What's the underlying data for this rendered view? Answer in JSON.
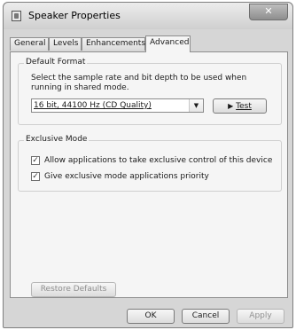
{
  "window": {
    "title": "Speaker Properties",
    "close_glyph": "✕"
  },
  "tabs": [
    {
      "label": "General"
    },
    {
      "label": "Levels"
    },
    {
      "label": "Enhancements"
    },
    {
      "label": "Advanced"
    }
  ],
  "active_tab": "Advanced",
  "default_format": {
    "legend": "Default Format",
    "description": "Select the sample rate and bit depth to be used when running in shared mode.",
    "selected_format": "16 bit, 44100 Hz (CD Quality)",
    "test_label": "Test"
  },
  "exclusive_mode": {
    "legend": "Exclusive Mode",
    "options": [
      {
        "label": "Allow applications to take exclusive control of this device",
        "checked": true
      },
      {
        "label": "Give exclusive mode applications priority",
        "checked": true
      }
    ]
  },
  "restore_defaults_label": "Restore Defaults",
  "buttons": {
    "ok": "OK",
    "cancel": "Cancel",
    "apply": "Apply"
  },
  "icons": {
    "check_glyph": "✓",
    "dropdown_glyph": "▼",
    "play_glyph": "▶"
  }
}
